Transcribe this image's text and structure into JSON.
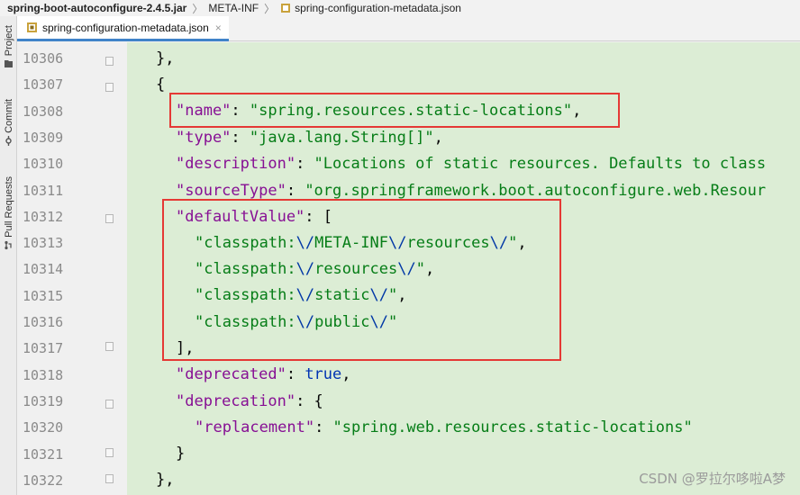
{
  "breadcrumb": {
    "jar": "spring-boot-autoconfigure-2.4.5.jar",
    "folder": "META-INF",
    "file": "spring-configuration-metadata.json"
  },
  "tool_windows": {
    "project": "Project",
    "commit": "Commit",
    "pull_requests": "Pull Requests"
  },
  "tab": {
    "title": "spring-configuration-metadata.json",
    "close": "×"
  },
  "lines": [
    {
      "num": "10306"
    },
    {
      "num": "10307"
    },
    {
      "num": "10308"
    },
    {
      "num": "10309"
    },
    {
      "num": "10310"
    },
    {
      "num": "10311"
    },
    {
      "num": "10312"
    },
    {
      "num": "10313"
    },
    {
      "num": "10314"
    },
    {
      "num": "10315"
    },
    {
      "num": "10316"
    },
    {
      "num": "10317"
    },
    {
      "num": "10318"
    },
    {
      "num": "10319"
    },
    {
      "num": "10320"
    },
    {
      "num": "10321"
    },
    {
      "num": "10322"
    }
  ],
  "code": {
    "l0": "},",
    "l1": "{",
    "l2_key": "\"name\"",
    "l2_val": "\"spring.resources.static-locations\"",
    "l3_key": "\"type\"",
    "l3_val": "\"java.lang.String[]\"",
    "l4_key": "\"description\"",
    "l4_val": "\"Locations of static resources. Defaults to class",
    "l5_key": "\"sourceType\"",
    "l5_val": "\"org.springframework.boot.autoconfigure.web.Resour",
    "l6_key": "\"defaultValue\"",
    "l7_a": "\"classpath:",
    "l7_e1": "\\/",
    "l7_b": "META-INF",
    "l7_e2": "\\/",
    "l7_c": "resources",
    "l7_e3": "\\/",
    "l7_d": "\"",
    "l8_a": "\"classpath:",
    "l8_e1": "\\/",
    "l8_b": "resources",
    "l8_e2": "\\/",
    "l8_c": "\"",
    "l9_a": "\"classpath:",
    "l9_e1": "\\/",
    "l9_b": "static",
    "l9_e2": "\\/",
    "l9_c": "\"",
    "l10_a": "\"classpath:",
    "l10_e1": "\\/",
    "l10_b": "public",
    "l10_e2": "\\/",
    "l10_c": "\"",
    "l11": "],",
    "l12_key": "\"deprecated\"",
    "l12_val": "true",
    "l13_key": "\"deprecation\"",
    "l14_key": "\"replacement\"",
    "l14_val": "\"spring.web.resources.static-locations\"",
    "l15": "}",
    "l16": "},"
  },
  "watermark": "CSDN @罗拉尔哆啦A梦",
  "colors": {
    "editor_bg": "#dcedd5",
    "key": "#871094",
    "string": "#067d17",
    "escape": "#0037a6",
    "keyword": "#0033b3",
    "highlight_box": "#e53935",
    "tab_underline": "#4083c9"
  }
}
